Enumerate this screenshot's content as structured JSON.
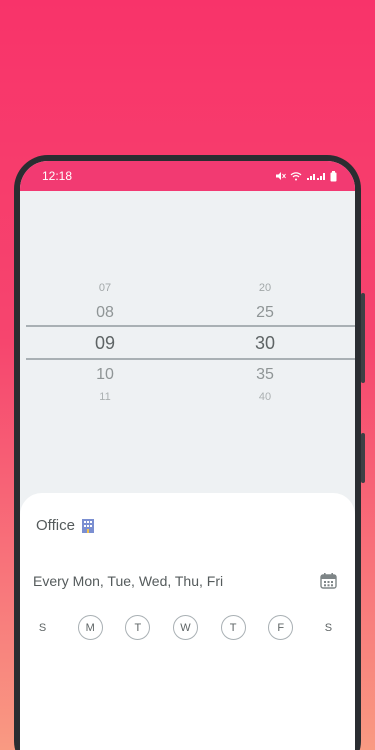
{
  "statusbar": {
    "time": "12:18",
    "icons": [
      "mute-icon",
      "wifi-icon",
      "signal-icon",
      "battery-icon"
    ]
  },
  "picker": {
    "hours": [
      "07",
      "08",
      "09",
      "10",
      "11"
    ],
    "minutes": [
      "20",
      "25",
      "30",
      "35",
      "40"
    ],
    "selected_hour": "09",
    "selected_minute": "30"
  },
  "sheet": {
    "label": "Office",
    "label_icon": "office-building-icon",
    "repeat_text": "Every Mon, Tue, Wed, Thu, Fri",
    "days": [
      {
        "letter": "S",
        "active": false
      },
      {
        "letter": "M",
        "active": true
      },
      {
        "letter": "T",
        "active": true
      },
      {
        "letter": "W",
        "active": true
      },
      {
        "letter": "T",
        "active": true
      },
      {
        "letter": "F",
        "active": true
      },
      {
        "letter": "S",
        "active": false
      }
    ]
  },
  "colors": {
    "statusbar": "#f23a72",
    "background_top": "#f8336a",
    "background_bottom": "#f99a82"
  }
}
